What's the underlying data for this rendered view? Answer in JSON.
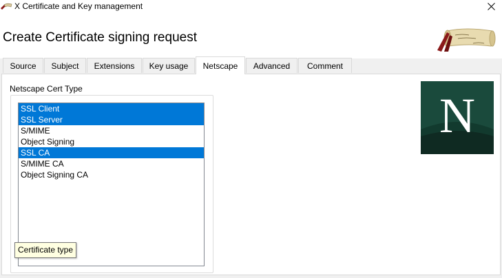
{
  "window": {
    "title": "X Certificate and Key management"
  },
  "header": {
    "title": "Create Certificate signing request"
  },
  "tabs": [
    {
      "label": "Source",
      "active": false
    },
    {
      "label": "Subject",
      "active": false
    },
    {
      "label": "Extensions",
      "active": false
    },
    {
      "label": "Key usage",
      "active": false
    },
    {
      "label": "Netscape",
      "active": true
    },
    {
      "label": "Advanced",
      "active": false
    },
    {
      "label": "Comment",
      "active": false
    }
  ],
  "netscape": {
    "group_label": "Netscape Cert Type",
    "cert_types": [
      {
        "label": "SSL Client",
        "selected": true
      },
      {
        "label": "SSL Server",
        "selected": true
      },
      {
        "label": "S/MIME",
        "selected": false
      },
      {
        "label": "Object Signing",
        "selected": false
      },
      {
        "label": "SSL CA",
        "selected": true
      },
      {
        "label": "S/MIME CA",
        "selected": false
      },
      {
        "label": "Object Signing CA",
        "selected": false
      }
    ],
    "logo_letter": "N",
    "tooltip": "Certificate type"
  },
  "colors": {
    "selection": "#0078d7",
    "logo_background": "#1a4a3c",
    "tooltip_background": "#ffffe1"
  },
  "icons": {
    "app": "certificate-scroll-icon",
    "close": "close-icon",
    "header_logo": "scroll-ribbon-logo",
    "netscape_logo": "netscape-logo"
  }
}
